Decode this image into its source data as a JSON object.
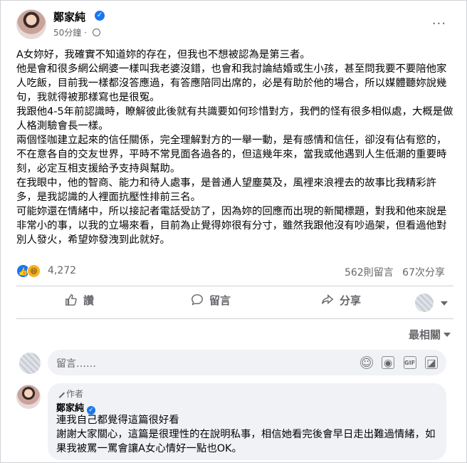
{
  "post": {
    "author": "鄭家純",
    "time": "50分鐘",
    "more": "···",
    "paragraphs": [
      "A女妳好，我確實不知道妳的存在，但我也不想被認為是第三者。",
      "他是會和很多網公網婆一樣叫我老婆沒錯，也會和我討論結婚或生小孩，甚至問我要不要陪他家人吃飯，目前我一樣都沒答應過，有答應陪同出席的，必是有助於他的場合，所以媒體聽妳說幾句，我就得被那樣寫也是很冤。",
      "我跟他4-5年前認識時，瞭解彼此後就有共識要如何珍惜對方，我們的怪有很多相似處，大概是做人格測驗會長一樣。",
      "兩個怪咖建立起來的信任關係，完全理解對方的一舉一動，是有感情和信任，卻沒有佔有慾的，不在意各自的交友世界，平時不常見面各過各的，但這幾年來，當我或他遇到人生低潮的重要時刻，必定互相支援給予支持與幫助。",
      "在我眼中，他的智商、能力和待人處事，是普通人望塵莫及，風裡來浪裡去的故事比我精彩許多，是我認識的人裡面抗壓性排前三名。",
      "可能妳還在情緒中，所以接記者電話受訪了，因為妳的回應而出現的新聞標題，對我和他來說是非常小的事，以我的立場來看，目前為止覺得妳很有分寸，雖然我跟他沒有吵過架，但看過他對別人發火，希望妳發洩到此就好。"
    ]
  },
  "stats": {
    "reaction_count": "4,272",
    "comments": "562則留言",
    "shares": "67次分享"
  },
  "actions": {
    "like": "讚",
    "comment": "留言",
    "share": "分享"
  },
  "sort_label": "最相關",
  "comment_input": {
    "placeholder": "留言……"
  },
  "reply": {
    "badge": "作者",
    "name": "鄭家純",
    "lines": [
      "連我自己都覺得這篇很好看",
      "謝謝大家關心，這篇是很理性的在說明私事，相信她看完後會早日走出難過情緒，如果我被罵一罵會讓A女心情好一點也OK。"
    ]
  }
}
